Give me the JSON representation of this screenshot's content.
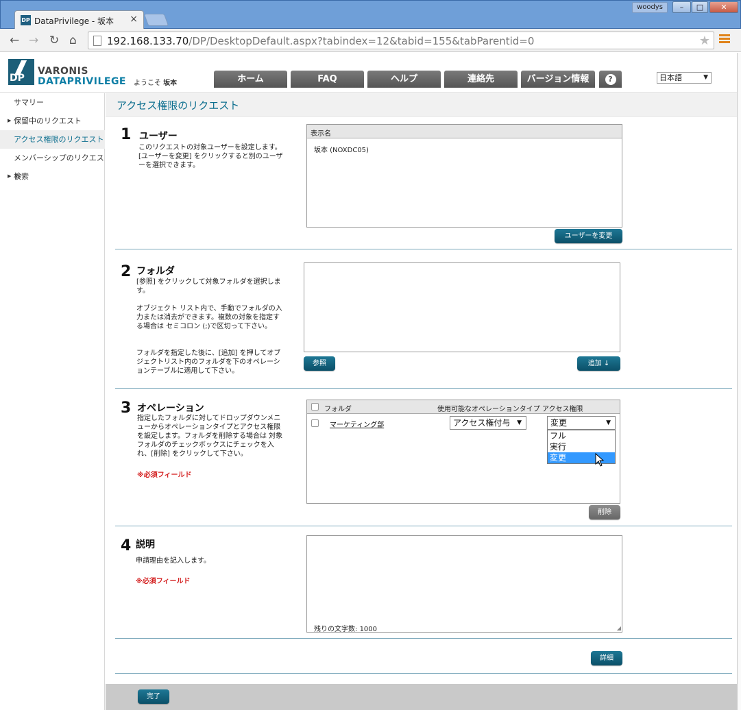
{
  "window": {
    "tab_title": "DataPrivilege - 坂本",
    "favicon_text": "DP",
    "user": "woodys"
  },
  "browser": {
    "url_host": "192.168.133.70",
    "url_path": "/DP/DesktopDefault.aspx?tabindex=12&tabid=155&tabParentid=0"
  },
  "header": {
    "logo_mark": "DP",
    "logo_line1": "VARONIS",
    "logo_line2": "DATAPRIVILEGE",
    "welcome_prefix": "ようこそ",
    "welcome_user": "坂本",
    "nav": [
      {
        "label": "ホーム"
      },
      {
        "label": "FAQ"
      },
      {
        "label": "ヘルプ"
      },
      {
        "label": "連絡先"
      },
      {
        "label": "バージョン情報"
      },
      {
        "label": "?"
      }
    ],
    "language": "日本語"
  },
  "sidebar": {
    "items": [
      {
        "label": "サマリー"
      },
      {
        "label": "保留中のリクエスト"
      },
      {
        "label": "アクセス権限のリクエスト"
      },
      {
        "label": "メンバーシップのリクエスト"
      },
      {
        "label": "検索"
      }
    ]
  },
  "page": {
    "title": "アクセス権限のリクエスト"
  },
  "step1": {
    "num": "1",
    "title": "ユーザー",
    "desc": "このリクエストの対象ユーザーを設定します。[ユーザーを変更] をクリックすると別のユーザーを選択できます。",
    "column": "表示名",
    "user": "坂本 (NOXDC05)",
    "change_button": "ユーザーを変更"
  },
  "step2": {
    "num": "2",
    "title": "フォルダ",
    "desc1": "[参照] をクリックして対象フォルダを選択します。",
    "desc2": "オブジェクト リスト内で、手動でフォルダの入力または消去ができます。複数の対象を指定する場合は セミコロン (;)で区切って下さい。",
    "desc3": "フォルダを指定した後に、[追加] を押してオブジェクトリスト内のフォルダを下のオペレーションテーブルに適用して下さい。",
    "browse_button": "参照",
    "add_button": "追加",
    "add_icon": "↓"
  },
  "step3": {
    "num": "3",
    "title": "オペレーション",
    "desc": "指定したフォルダに対してドロップダウンメニューからオペレーションタイプとアクセス権限を設定します。フォルダを削除する場合は 対象フォルダのチェックボックスにチェックを入れ、[削除] をクリックして下さい。",
    "required": "※必須フィールド",
    "columns": {
      "folder": "フォルダ",
      "op_type": "使用可能なオペレーションタイプ",
      "access": "アクセス権限"
    },
    "row": {
      "folder": "マーケティング部",
      "op_type": "アクセス権付与",
      "access": "変更"
    },
    "access_options": [
      "フル",
      "実行",
      "変更"
    ],
    "delete_button": "削除"
  },
  "step4": {
    "num": "4",
    "title": "説明",
    "desc": "申請理由を記入します。",
    "required": "※必須フィールド",
    "remaining_label": "残りの文字数:",
    "remaining_count": "1000",
    "details_button": "詳細"
  },
  "footer": {
    "done_button": "完了"
  }
}
